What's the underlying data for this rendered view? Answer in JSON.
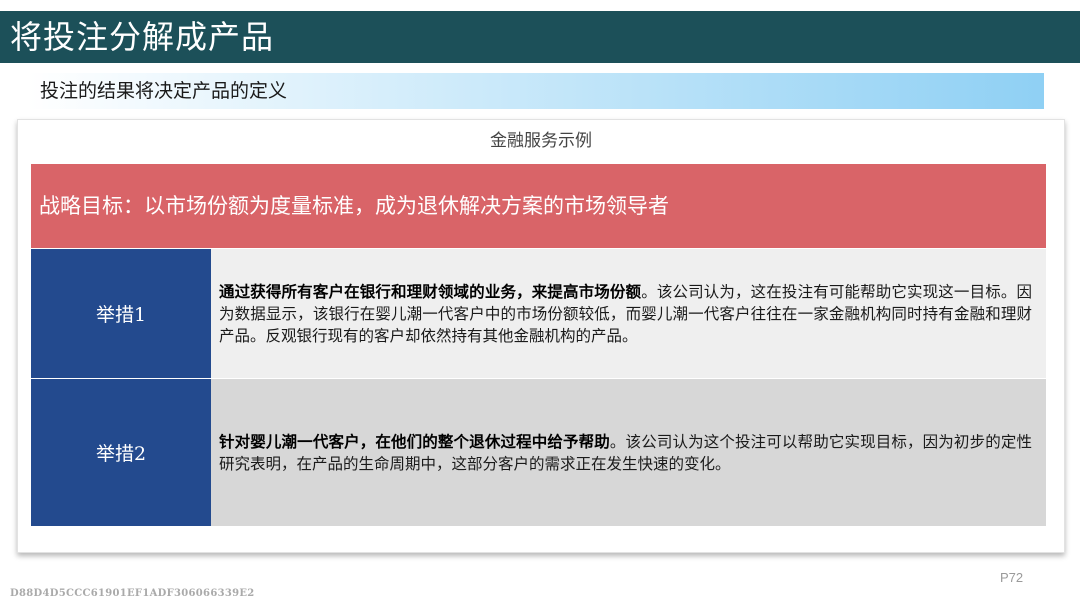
{
  "header": {
    "title": "将投注分解成产品",
    "subtitle": "投注的结果将决定产品的定义"
  },
  "panel": {
    "caption": "金融服务示例",
    "goal": "战略目标：以市场份额为度量标准，成为退休解决方案的市场领导者",
    "measures": [
      {
        "label": "举措1",
        "bold": "通过获得所有客户在银行和理财领域的业务，来提高市场份额",
        "text": "。该公司认为，这在投注有可能帮助它实现这一目标。因为数据显示，该银行在婴儿潮一代客户中的市场份额较低，而婴儿潮一代客户往往在一家金融机构同时持有金融和理财产品。反观银行现有的客户却依然持有其他金融机构的产品。"
      },
      {
        "label": "举措2",
        "bold": "针对婴儿潮一代客户，在他们的整个退休过程中给予帮助",
        "text": "。该公司认为这个投注可以帮助它实现目标，因为初步的定性研究表明，在产品的生命周期中，这部分客户的需求正在发生快速的变化。"
      }
    ]
  },
  "footer": {
    "page": "P72",
    "watermark": "D88D4D5CCC61901EF1ADF306066339E2"
  },
  "colors": {
    "title_bar": "#1c5059",
    "goal_bar": "#d96468",
    "measure_label": "#234a8e",
    "row1_bg": "#efefef",
    "row2_bg": "#d7d7d7"
  }
}
